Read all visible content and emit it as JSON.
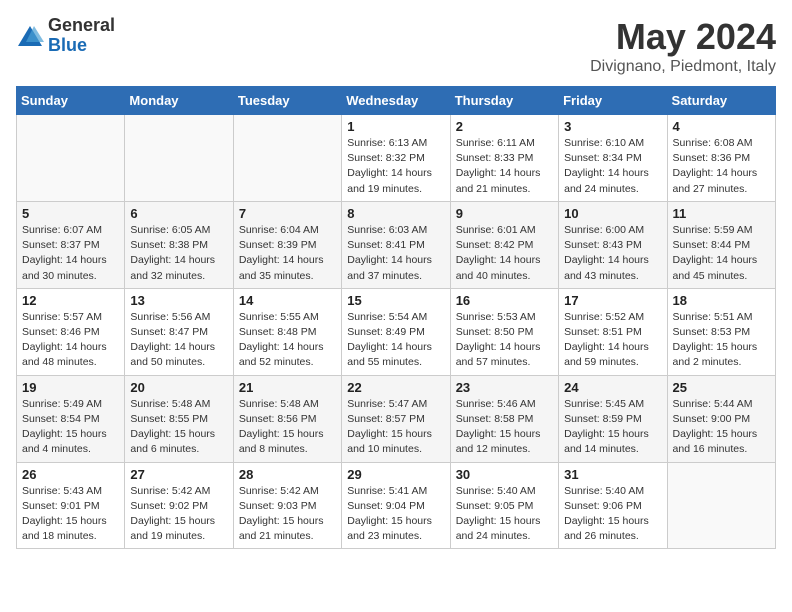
{
  "logo": {
    "general": "General",
    "blue": "Blue"
  },
  "title": "May 2024",
  "location": "Divignano, Piedmont, Italy",
  "weekdays": [
    "Sunday",
    "Monday",
    "Tuesday",
    "Wednesday",
    "Thursday",
    "Friday",
    "Saturday"
  ],
  "weeks": [
    [
      {
        "day": "",
        "info": ""
      },
      {
        "day": "",
        "info": ""
      },
      {
        "day": "",
        "info": ""
      },
      {
        "day": "1",
        "info": "Sunrise: 6:13 AM\nSunset: 8:32 PM\nDaylight: 14 hours\nand 19 minutes."
      },
      {
        "day": "2",
        "info": "Sunrise: 6:11 AM\nSunset: 8:33 PM\nDaylight: 14 hours\nand 21 minutes."
      },
      {
        "day": "3",
        "info": "Sunrise: 6:10 AM\nSunset: 8:34 PM\nDaylight: 14 hours\nand 24 minutes."
      },
      {
        "day": "4",
        "info": "Sunrise: 6:08 AM\nSunset: 8:36 PM\nDaylight: 14 hours\nand 27 minutes."
      }
    ],
    [
      {
        "day": "5",
        "info": "Sunrise: 6:07 AM\nSunset: 8:37 PM\nDaylight: 14 hours\nand 30 minutes."
      },
      {
        "day": "6",
        "info": "Sunrise: 6:05 AM\nSunset: 8:38 PM\nDaylight: 14 hours\nand 32 minutes."
      },
      {
        "day": "7",
        "info": "Sunrise: 6:04 AM\nSunset: 8:39 PM\nDaylight: 14 hours\nand 35 minutes."
      },
      {
        "day": "8",
        "info": "Sunrise: 6:03 AM\nSunset: 8:41 PM\nDaylight: 14 hours\nand 37 minutes."
      },
      {
        "day": "9",
        "info": "Sunrise: 6:01 AM\nSunset: 8:42 PM\nDaylight: 14 hours\nand 40 minutes."
      },
      {
        "day": "10",
        "info": "Sunrise: 6:00 AM\nSunset: 8:43 PM\nDaylight: 14 hours\nand 43 minutes."
      },
      {
        "day": "11",
        "info": "Sunrise: 5:59 AM\nSunset: 8:44 PM\nDaylight: 14 hours\nand 45 minutes."
      }
    ],
    [
      {
        "day": "12",
        "info": "Sunrise: 5:57 AM\nSunset: 8:46 PM\nDaylight: 14 hours\nand 48 minutes."
      },
      {
        "day": "13",
        "info": "Sunrise: 5:56 AM\nSunset: 8:47 PM\nDaylight: 14 hours\nand 50 minutes."
      },
      {
        "day": "14",
        "info": "Sunrise: 5:55 AM\nSunset: 8:48 PM\nDaylight: 14 hours\nand 52 minutes."
      },
      {
        "day": "15",
        "info": "Sunrise: 5:54 AM\nSunset: 8:49 PM\nDaylight: 14 hours\nand 55 minutes."
      },
      {
        "day": "16",
        "info": "Sunrise: 5:53 AM\nSunset: 8:50 PM\nDaylight: 14 hours\nand 57 minutes."
      },
      {
        "day": "17",
        "info": "Sunrise: 5:52 AM\nSunset: 8:51 PM\nDaylight: 14 hours\nand 59 minutes."
      },
      {
        "day": "18",
        "info": "Sunrise: 5:51 AM\nSunset: 8:53 PM\nDaylight: 15 hours\nand 2 minutes."
      }
    ],
    [
      {
        "day": "19",
        "info": "Sunrise: 5:49 AM\nSunset: 8:54 PM\nDaylight: 15 hours\nand 4 minutes."
      },
      {
        "day": "20",
        "info": "Sunrise: 5:48 AM\nSunset: 8:55 PM\nDaylight: 15 hours\nand 6 minutes."
      },
      {
        "day": "21",
        "info": "Sunrise: 5:48 AM\nSunset: 8:56 PM\nDaylight: 15 hours\nand 8 minutes."
      },
      {
        "day": "22",
        "info": "Sunrise: 5:47 AM\nSunset: 8:57 PM\nDaylight: 15 hours\nand 10 minutes."
      },
      {
        "day": "23",
        "info": "Sunrise: 5:46 AM\nSunset: 8:58 PM\nDaylight: 15 hours\nand 12 minutes."
      },
      {
        "day": "24",
        "info": "Sunrise: 5:45 AM\nSunset: 8:59 PM\nDaylight: 15 hours\nand 14 minutes."
      },
      {
        "day": "25",
        "info": "Sunrise: 5:44 AM\nSunset: 9:00 PM\nDaylight: 15 hours\nand 16 minutes."
      }
    ],
    [
      {
        "day": "26",
        "info": "Sunrise: 5:43 AM\nSunset: 9:01 PM\nDaylight: 15 hours\nand 18 minutes."
      },
      {
        "day": "27",
        "info": "Sunrise: 5:42 AM\nSunset: 9:02 PM\nDaylight: 15 hours\nand 19 minutes."
      },
      {
        "day": "28",
        "info": "Sunrise: 5:42 AM\nSunset: 9:03 PM\nDaylight: 15 hours\nand 21 minutes."
      },
      {
        "day": "29",
        "info": "Sunrise: 5:41 AM\nSunset: 9:04 PM\nDaylight: 15 hours\nand 23 minutes."
      },
      {
        "day": "30",
        "info": "Sunrise: 5:40 AM\nSunset: 9:05 PM\nDaylight: 15 hours\nand 24 minutes."
      },
      {
        "day": "31",
        "info": "Sunrise: 5:40 AM\nSunset: 9:06 PM\nDaylight: 15 hours\nand 26 minutes."
      },
      {
        "day": "",
        "info": ""
      }
    ]
  ]
}
